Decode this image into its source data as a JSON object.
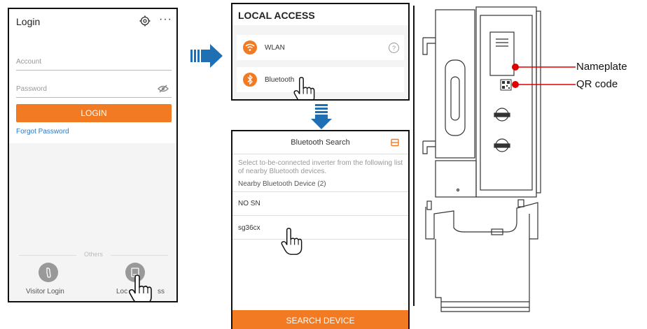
{
  "login": {
    "title": "Login",
    "account_placeholder": "Account",
    "password_placeholder": "Password",
    "login_button": "LOGIN",
    "forgot_password": "Forgot Password",
    "others_label": "Others",
    "visitor_login": "Visitor Login",
    "local_access_partial": "Loc",
    "local_access_partial2": "ss"
  },
  "local_access": {
    "title": "LOCAL ACCESS",
    "items": [
      {
        "label": "WLAN",
        "icon": "wifi-icon"
      },
      {
        "label": "Bluetooth",
        "icon": "bluetooth-icon"
      }
    ]
  },
  "bluetooth_search": {
    "title": "Bluetooth Search",
    "description": "Select to-be-connected inverter from the following list of nearby Bluetooth devices.",
    "nearby_label": "Nearby Bluetooth Device (2)",
    "devices": [
      "NO SN",
      "sg36cx"
    ],
    "search_button": "SEARCH DEVICE"
  },
  "device_diagram": {
    "nameplate_label": "Nameplate",
    "qr_label": "QR code"
  },
  "colors": {
    "accent": "#f27a23",
    "arrow_blue": "#1f6fb5",
    "link_blue": "#2a78c7",
    "marker_red": "#e00000"
  }
}
